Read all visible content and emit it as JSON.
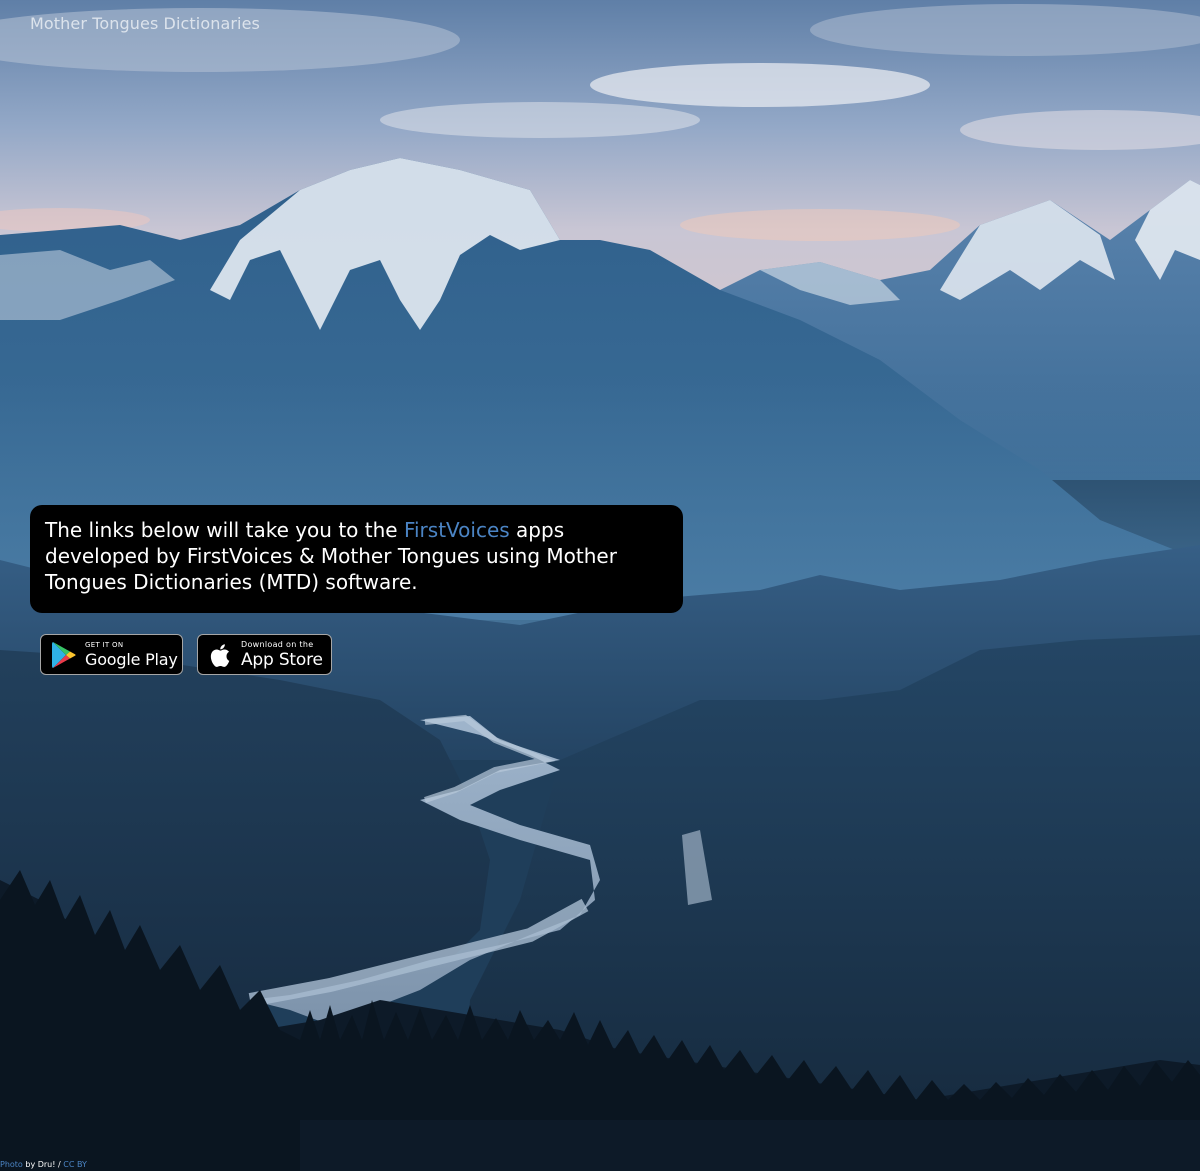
{
  "site": {
    "title": "Mother Tongues Dictionaries"
  },
  "info": {
    "text_before": "The links below will take you to the ",
    "link_text": "FirstVoices",
    "text_after": " apps developed by FirstVoices & Mother Tongues using Mother Tongues Dictionaries (MTD) software."
  },
  "badges": {
    "google": {
      "small": "GET IT ON",
      "big": "Google Play"
    },
    "apple": {
      "small": "Download on the",
      "big": "App Store"
    }
  },
  "credit": {
    "photo_label": "Photo",
    "by_text": " by Dru! / ",
    "license": "CC BY"
  },
  "colors": {
    "link": "#4b84c4",
    "box_bg": "#000000",
    "text": "#ffffff"
  }
}
